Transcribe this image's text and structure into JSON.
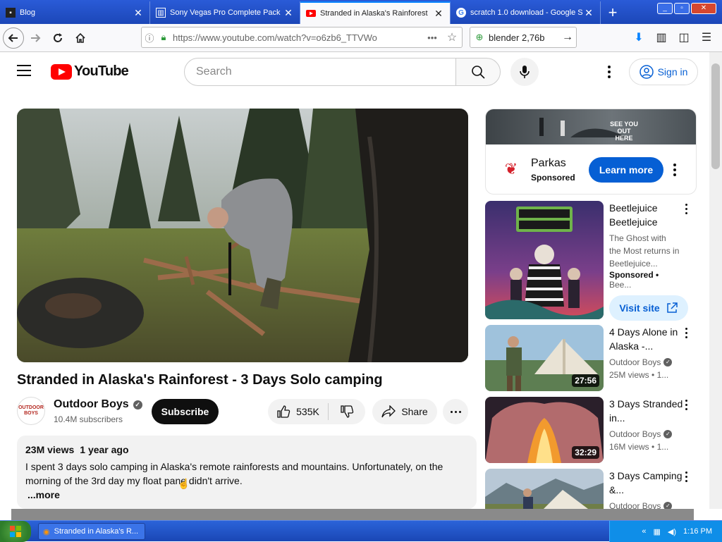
{
  "browser": {
    "tabs": [
      {
        "title": "Blog",
        "active": false,
        "icon": "blog-favicon"
      },
      {
        "title": "Sony Vegas Pro Complete Pack",
        "active": false,
        "icon": "document-favicon"
      },
      {
        "title": "Stranded in Alaska's Rainforest",
        "active": true,
        "icon": "youtube-favicon"
      },
      {
        "title": "scratch 1.0 download - Google S",
        "active": false,
        "icon": "google-favicon"
      }
    ],
    "new_tab": "+",
    "url": "https://www.youtube.com/watch?v=o6zb6_TTVWo",
    "search_text": "blender 2,76b"
  },
  "youtube": {
    "logo_text": "YouTube",
    "search_placeholder": "Search",
    "signin_label": "Sign in",
    "video": {
      "title": "Stranded in Alaska's Rainforest - 3 Days Solo camping",
      "channel": "Outdoor Boys",
      "channel_avatar_text": "OUTDOOR BOYS",
      "subscribers": "10.4M subscribers",
      "subscribe_label": "Subscribe",
      "likes": "535K",
      "share_label": "Share",
      "views": "23M views",
      "age": "1 year ago",
      "description": "I spent 3 days solo camping in Alaska's remote rainforests and mountains. Unfortunately, on the morning of the 3rd day my float pane didn't arrive.",
      "more_label": "...more"
    },
    "ad": {
      "banner_text": "SEE YOU OUT HERE",
      "name": "Parkas",
      "sponsored": "Sponsored",
      "cta": "Learn more"
    },
    "sponsored_card": {
      "title": "Beetlejuice Beetlejuice",
      "description": "The Ghost with the Most returns in Beetlejuice...",
      "sponsored": "Sponsored",
      "advertiser": "Bee...",
      "cta": "Visit site"
    },
    "recommendations": [
      {
        "title": "4 Days Alone in Alaska -...",
        "channel": "Outdoor Boys",
        "views": "25M views",
        "age": "1...",
        "duration": "27:56"
      },
      {
        "title": "3 Days Stranded in...",
        "channel": "Outdoor Boys",
        "views": "16M views",
        "age": "1...",
        "duration": "32:29"
      },
      {
        "title": "3 Days Camping &...",
        "channel": "Outdoor Boys",
        "views": "",
        "age": "",
        "duration": ""
      }
    ]
  },
  "taskbar": {
    "start_label": "start",
    "window_item": "Stranded in Alaska's R...",
    "clock": "1:16 PM"
  },
  "colors": {
    "youtube_red": "#ff0000",
    "link_blue": "#065fd4",
    "firefox_tab_blue": "#1c47b8"
  }
}
